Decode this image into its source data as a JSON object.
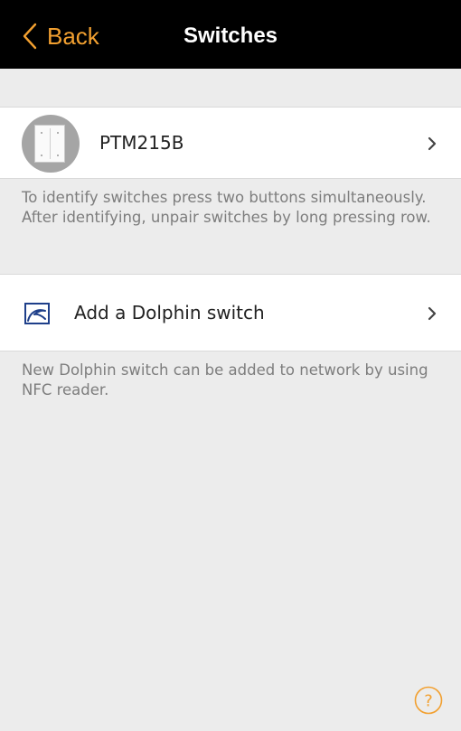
{
  "nav": {
    "back_label": "Back",
    "title": "Switches"
  },
  "devices": [
    {
      "name": "PTM215B",
      "icon": "switch-plate-icon"
    }
  ],
  "device_help": "To identify switches press two buttons simultaneously. After identifying, unpair switches by long pressing row.",
  "add_row": {
    "label": "Add a Dolphin switch",
    "icon": "dolphin-icon"
  },
  "add_help": "New Dolphin switch can be added to network by using NFC reader.",
  "help_button": {
    "glyph": "?"
  },
  "colors": {
    "accent": "#f2a030",
    "nav_background": "#000000",
    "page_background": "#ececec",
    "row_background": "#ffffff",
    "secondary_text": "#7d7d7d",
    "dolphin_icon": "#1e3f8a"
  }
}
